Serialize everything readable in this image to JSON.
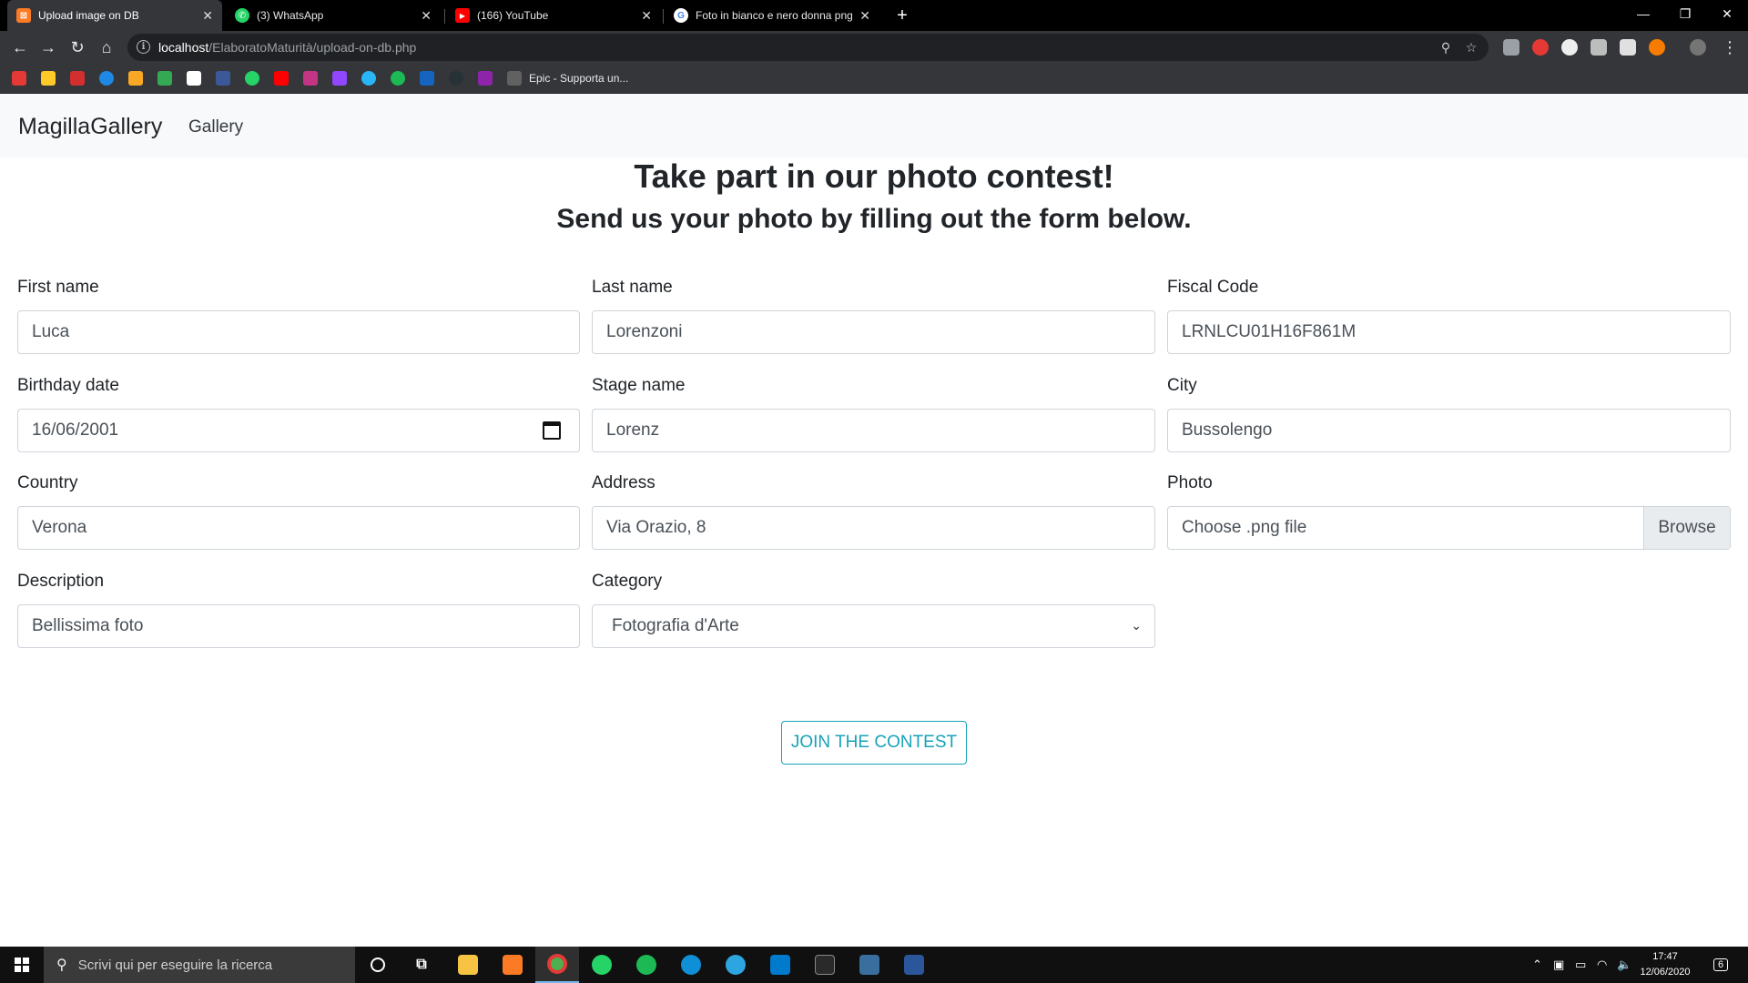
{
  "browser": {
    "tabs": [
      {
        "label": "Upload image on DB",
        "icon": "xampp-icon",
        "color": "#fb7a24",
        "glyph": "⊠"
      },
      {
        "label": "(3) WhatsApp",
        "icon": "whatsapp-icon",
        "color": "#25d366",
        "glyph": "✆"
      },
      {
        "label": "(166) YouTube",
        "icon": "youtube-icon",
        "color": "#ff0000",
        "glyph": "▶"
      },
      {
        "label": "Foto in bianco e nero donna png",
        "icon": "google-icon",
        "color": "#ffffff",
        "glyph": "G"
      }
    ],
    "new_tab_glyph": "+",
    "url_host": "localhost",
    "url_path": "/ElaboratoMaturità/upload-on-db.php",
    "bookmark_text": "Epic - Supporta un..."
  },
  "page": {
    "brand": "MagillaGallery",
    "nav_gallery": "Gallery",
    "title": "Take part in our photo contest!",
    "subtitle": "Send us your photo by filling out the form below.",
    "form": {
      "first_name_label": "First name",
      "first_name_value": "Luca",
      "last_name_label": "Last name",
      "last_name_value": "Lorenzoni",
      "fiscal_code_label": "Fiscal Code",
      "fiscal_code_value": "LRNLCU01H16F861M",
      "birthday_label": "Birthday date",
      "birthday_value": "16/06/2001",
      "stage_name_label": "Stage name",
      "stage_name_value": "Lorenz",
      "city_label": "City",
      "city_value": "Bussolengo",
      "country_label": "Country",
      "country_value": "Verona",
      "address_label": "Address",
      "address_value": "Via Orazio, 8",
      "photo_label": "Photo",
      "photo_placeholder": "Choose .png file",
      "photo_browse": "Browse",
      "description_label": "Description",
      "description_value": "Bellissima foto",
      "category_label": "Category",
      "category_value": "Fotografia d'Arte"
    },
    "submit_label": "JOIN THE CONTEST",
    "accent_color": "#17a2b8"
  },
  "taskbar": {
    "search_placeholder": "Scrivi qui per eseguire la ricerca",
    "time": "17:47",
    "date": "12/06/2020",
    "notifications": "6"
  }
}
